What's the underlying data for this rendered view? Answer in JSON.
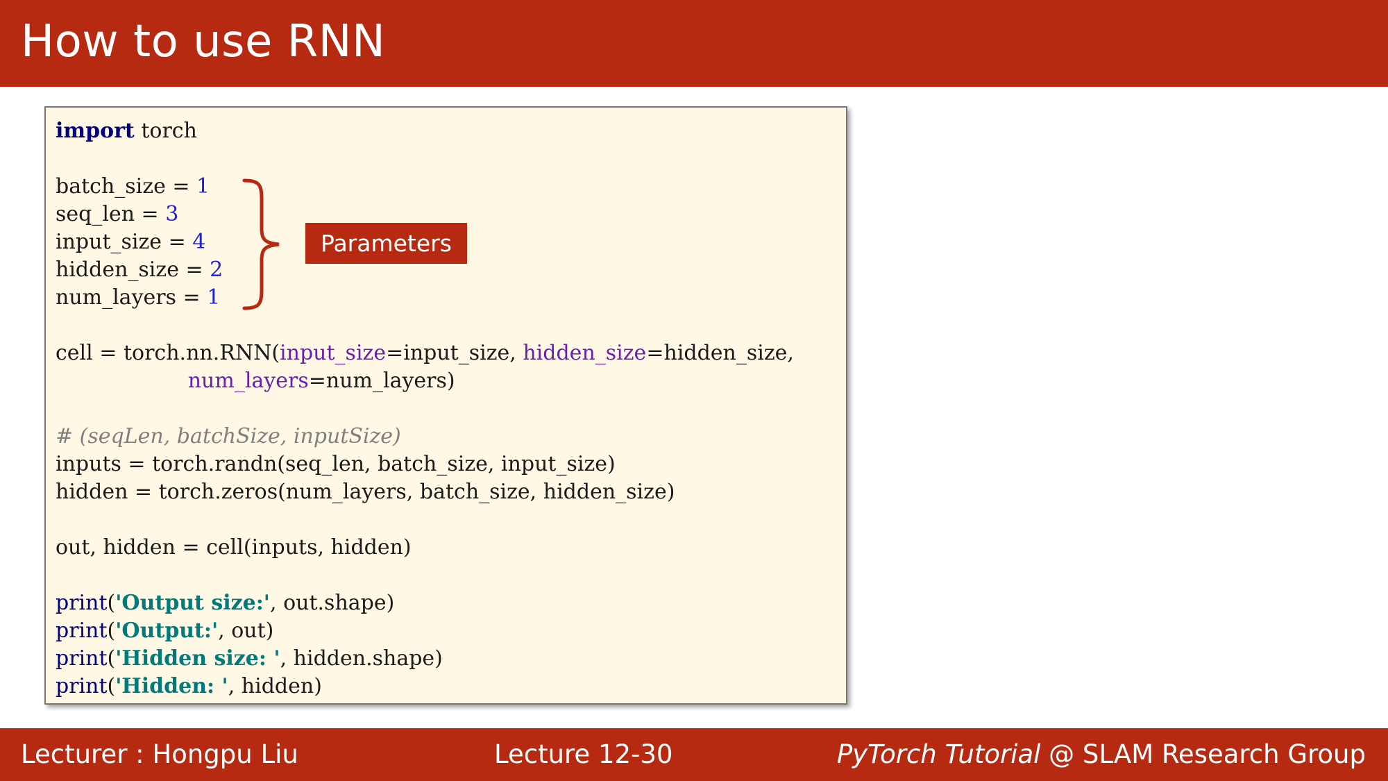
{
  "slide": {
    "title": "How to use RNN"
  },
  "annotation": {
    "label": "Parameters"
  },
  "code": {
    "l1": [
      "import",
      " torch"
    ],
    "l3": [
      "batch_size = ",
      "1"
    ],
    "l4": [
      "seq_len = ",
      "3"
    ],
    "l5": [
      "input_size = ",
      "4"
    ],
    "l6": [
      "hidden_size = ",
      "2"
    ],
    "l7": [
      "num_layers = ",
      "1"
    ],
    "l9": [
      "cell = torch.nn.RNN(",
      "input_size",
      "=input_size, ",
      "hidden_size",
      "=hidden_size,"
    ],
    "l10": [
      "                    ",
      "num_layers",
      "=num_layers)"
    ],
    "l12": [
      "# (seqLen, batchSize, inputSize)"
    ],
    "l13": [
      "inputs = torch.randn(seq_len, batch_size, input_size)"
    ],
    "l14": [
      "hidden = torch.zeros(num_layers, batch_size, hidden_size)"
    ],
    "l16": [
      "out, hidden = cell(inputs, hidden)"
    ],
    "l18": [
      "print",
      "(",
      "'Output size:'",
      ", out.shape)"
    ],
    "l19": [
      "print",
      "(",
      "'Output:'",
      ", out)"
    ],
    "l20": [
      "print",
      "(",
      "'Hidden size: '",
      ", hidden.shape)"
    ],
    "l21": [
      "print",
      "(",
      "'Hidden: '",
      ", hidden)"
    ]
  },
  "footer": {
    "lecturer": "Lecturer : Hongpu Liu",
    "lecture": "Lecture 12-30",
    "course": "PyTorch Tutorial",
    "group": " @ SLAM Research Group"
  },
  "colors": {
    "brand": "#b72a12",
    "code_bg": "#fff8e4",
    "keyword": "#000080",
    "number": "#1e22d6",
    "param": "#6a1fb0",
    "string": "#007a7a",
    "comment": "#7f7f7f"
  }
}
